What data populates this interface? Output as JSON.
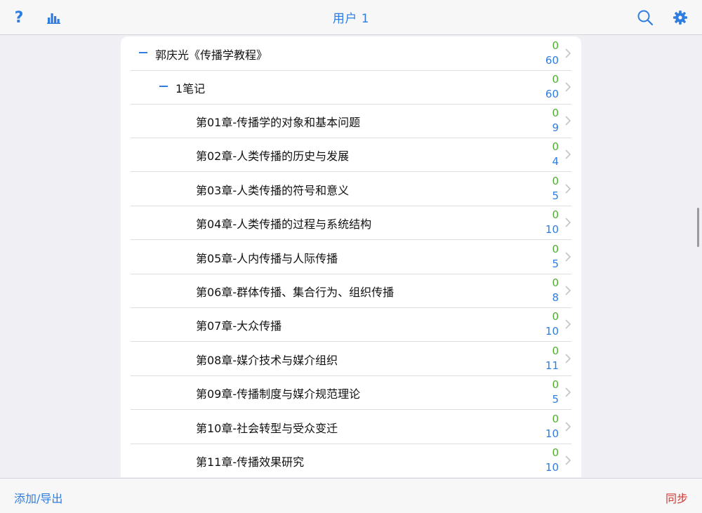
{
  "header": {
    "title": "用户 1",
    "help_glyph": "?"
  },
  "icons": {
    "help": "question-mark-icon",
    "stats": "bar-chart-icon",
    "search": "search-icon",
    "settings": "gear-icon",
    "chevron": "chevron-right-icon",
    "collapse": "minus-icon"
  },
  "colors": {
    "accent": "#2f7de1",
    "count_green": "#4caf2c",
    "sync_red": "#d0362f"
  },
  "tree": {
    "root": {
      "label": "郭庆光《传播学教程》",
      "count_top": "0",
      "count_bottom": "60"
    },
    "folder": {
      "label": "1笔记",
      "count_top": "0",
      "count_bottom": "60"
    },
    "chapters": [
      {
        "label": "第01章-传播学的对象和基本问题",
        "count_top": "0",
        "count_bottom": "9"
      },
      {
        "label": "第02章-人类传播的历史与发展",
        "count_top": "0",
        "count_bottom": "4"
      },
      {
        "label": "第03章-人类传播的符号和意义",
        "count_top": "0",
        "count_bottom": "5"
      },
      {
        "label": "第04章-人类传播的过程与系统结构",
        "count_top": "0",
        "count_bottom": "10"
      },
      {
        "label": "第05章-人内传播与人际传播",
        "count_top": "0",
        "count_bottom": "5"
      },
      {
        "label": "第06章-群体传播、集合行为、组织传播",
        "count_top": "0",
        "count_bottom": "8"
      },
      {
        "label": "第07章-大众传播",
        "count_top": "0",
        "count_bottom": "10"
      },
      {
        "label": "第08章-媒介技术与媒介组织",
        "count_top": "0",
        "count_bottom": "11"
      },
      {
        "label": "第09章-传播制度与媒介规范理论",
        "count_top": "0",
        "count_bottom": "5"
      },
      {
        "label": "第10章-社会转型与受众变迁",
        "count_top": "0",
        "count_bottom": "10"
      },
      {
        "label": "第11章-传播效果研究",
        "count_top": "0",
        "count_bottom": "10"
      }
    ]
  },
  "footer": {
    "add_export": "添加/导出",
    "sync": "同步"
  }
}
